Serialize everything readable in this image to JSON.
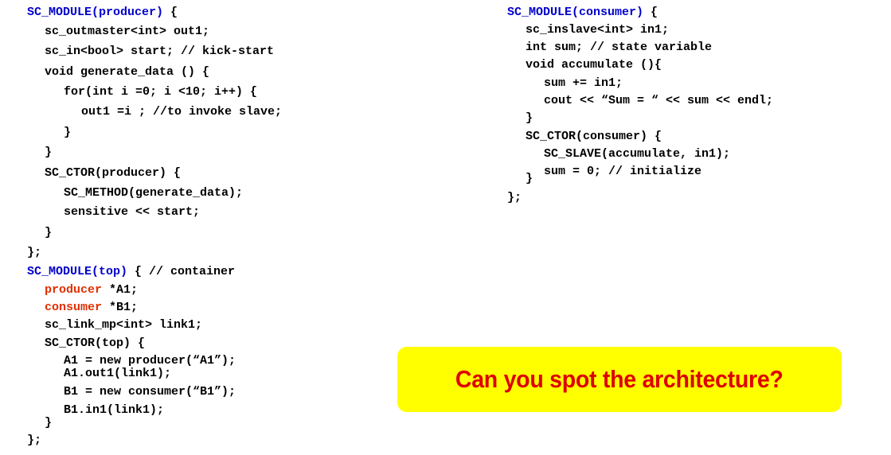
{
  "left_code": {
    "l1_module": "SC_MODULE(producer)",
    "l1_rest": " {",
    "l2": "sc_outmaster<int> out1;",
    "l3": "sc_in<bool> start; // kick-start",
    "l4": "void generate_data () {",
    "l5": "for(int i =0; i <10; i++) {",
    "l6": "out1 =i ; //to invoke slave;",
    "l7": "}",
    "l8": "}",
    "l9": "SC_CTOR(producer) {",
    "l10": "SC_METHOD(generate_data);",
    "l11": "sensitive << start;",
    "l12": "}",
    "l13": "};",
    "l14_module": "SC_MODULE(top)",
    "l14_rest": " { // container",
    "l15_type": "producer",
    "l15_rest": " *A1;",
    "l16_type": "consumer",
    "l16_rest": " *B1;",
    "l17": "sc_link_mp<int> link1;",
    "l18": "SC_CTOR(top) {",
    "l19": "A1 = new producer(“A1”);",
    "l20": "A1.out1(link1);",
    "l21": "B1 = new consumer(“B1”);",
    "l22": "B1.in1(link1);",
    "l23": "}",
    "l24": "};"
  },
  "right_code": {
    "r1_module": "SC_MODULE(consumer)",
    "r1_rest": " {",
    "r2": "sc_inslave<int> in1;",
    "r3": "int sum; // state variable",
    "r4": "void accumulate (){",
    "r5": "sum += in1;",
    "r6": "cout << “Sum = “ << sum << endl;",
    "r7": "}",
    "r8": "SC_CTOR(consumer) {",
    "r9": "SC_SLAVE(accumulate, in1);",
    "r10": "sum = 0; // initialize",
    "r11": "}",
    "r12": "};"
  },
  "callout": {
    "text": "Can you spot the architecture?"
  },
  "colors": {
    "module_keyword": "#0000cc",
    "instance_type": "#e03000",
    "callout_background": "#ffff00",
    "callout_text": "#dd0000"
  }
}
